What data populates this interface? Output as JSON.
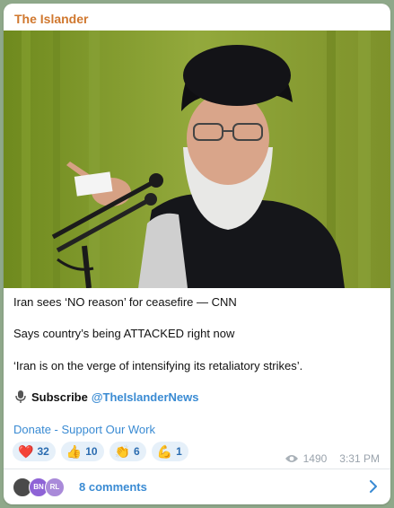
{
  "post": {
    "channel_name": "The Islander",
    "image_alt": "photo",
    "lines": [
      "Iran sees ‘NO reason’ for ceasefire — CNN",
      "Says country’s being ATTACKED right now",
      "‘Iran is on the verge of intensifying its retaliatory strikes’."
    ],
    "subscribe": {
      "label": "Subscribe",
      "handle": "@TheIslanderNews"
    },
    "donate_link": "Donate - Support Our Work"
  },
  "reactions": [
    {
      "icon": "heart-icon",
      "emoji": "❤️",
      "count": "32"
    },
    {
      "icon": "thumbs-up-icon",
      "emoji": "👍",
      "count": "10"
    },
    {
      "icon": "clapping-hands-icon",
      "emoji": "👏",
      "count": "6"
    },
    {
      "icon": "muscle-icon",
      "emoji": "💪",
      "count": "1"
    }
  ],
  "meta": {
    "views": "1490",
    "time": "3:31 PM"
  },
  "comments": {
    "avatars": [
      "",
      "BN",
      "RL"
    ],
    "label": "8 comments"
  },
  "colors": {
    "channel": "#d0782f",
    "link": "#3a8bd3",
    "reaction_bg": "#e6f0f9",
    "photo_bg": "#7e8f2c"
  }
}
